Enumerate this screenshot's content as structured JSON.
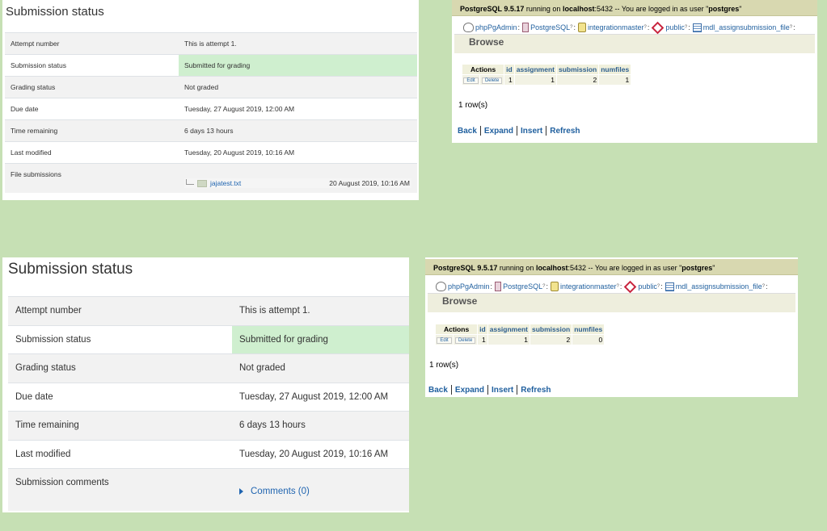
{
  "submission_top": {
    "title": "Submission status",
    "rows": [
      {
        "label": "Attempt number",
        "value": "This is attempt 1."
      },
      {
        "label": "Submission status",
        "value": "Submitted for grading"
      },
      {
        "label": "Grading status",
        "value": "Not graded"
      },
      {
        "label": "Due date",
        "value": "Tuesday, 27 August 2019, 12:00 AM"
      },
      {
        "label": "Time remaining",
        "value": "6 days 13 hours"
      },
      {
        "label": "Last modified",
        "value": "Tuesday, 20 August 2019, 10:16 AM"
      }
    ],
    "files_label": "File submissions",
    "file": {
      "name": "jajatest.txt",
      "date": "20 August 2019, 10:16 AM",
      "icon": "text-file-icon"
    }
  },
  "submission_bottom": {
    "title": "Submission status",
    "rows": [
      {
        "label": "Attempt number",
        "value": "This is attempt 1."
      },
      {
        "label": "Submission status",
        "value": "Submitted for grading"
      },
      {
        "label": "Grading status",
        "value": "Not graded"
      },
      {
        "label": "Due date",
        "value": "Tuesday, 27 August 2019, 12:00 AM"
      },
      {
        "label": "Time remaining",
        "value": "6 days 13 hours"
      },
      {
        "label": "Last modified",
        "value": "Tuesday, 20 August 2019, 10:16 AM"
      }
    ],
    "comments_label": "Submission comments",
    "comments_link": "Comments (0)"
  },
  "pg_common": {
    "version_prefix": "PostgreSQL 9.5.17",
    "running_on": "running on",
    "host": "localhost",
    "port_text": ":5432 -- You are logged in as user \"",
    "user": "postgres",
    "quote_close": "\"",
    "crumbs": [
      "phpPgAdmin",
      "PostgreSQL",
      "integrationmaster",
      "public",
      "mdl_assignsubmission_file"
    ],
    "tab": "Browse",
    "columns": [
      "Actions",
      "id",
      "assignment",
      "submission",
      "numfiles"
    ],
    "edit": "Edit",
    "delete": "Delete",
    "row_count": "1 row(s)",
    "nav": [
      "Back",
      "Expand",
      "Insert",
      "Refresh"
    ]
  },
  "pg_top": {
    "row": {
      "id": "1",
      "assignment": "1",
      "submission": "2",
      "numfiles": "1"
    }
  },
  "pg_bottom": {
    "row": {
      "id": "1",
      "assignment": "1",
      "submission": "2",
      "numfiles": "0"
    }
  },
  "colors": {
    "background": "#c6e0b4",
    "status_ok": "#cfefcf",
    "link": "#1f64b0",
    "pg_header": "#d8d8b0"
  }
}
